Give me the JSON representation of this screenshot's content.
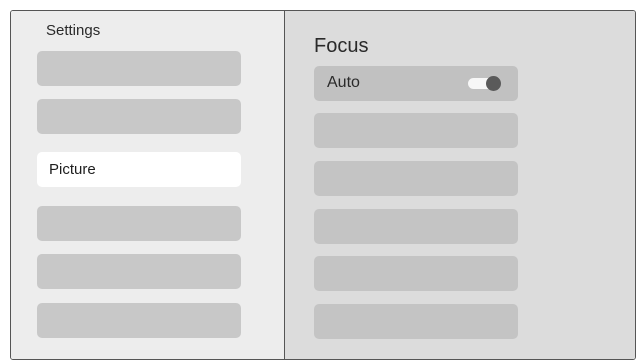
{
  "settings_menu": {
    "title": "Settings",
    "items": [
      {
        "label": ""
      },
      {
        "label": ""
      },
      {
        "label": "Picture",
        "selected": true
      },
      {
        "label": ""
      },
      {
        "label": ""
      },
      {
        "label": ""
      }
    ]
  },
  "focus_panel": {
    "title": "Focus",
    "items": [
      {
        "label": "Auto",
        "toggle": {
          "state": "on"
        }
      },
      {
        "label": ""
      },
      {
        "label": ""
      },
      {
        "label": ""
      },
      {
        "label": ""
      },
      {
        "label": ""
      }
    ]
  },
  "colors": {
    "left_panel_bg": "#ededed",
    "right_panel_bg": "#dcdcdc",
    "item_bg": "#c8c8c8",
    "selected_item_bg": "#ffffff",
    "toggle_knob": "#5a5a5a"
  }
}
